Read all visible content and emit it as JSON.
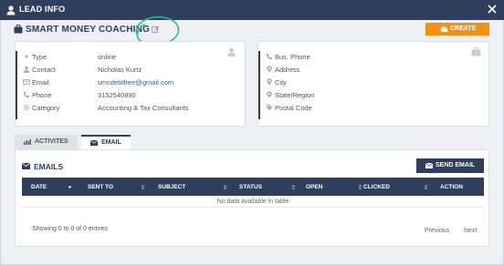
{
  "window": {
    "title": "LEAD INFO",
    "title_icon": "user-icon",
    "close_icon": "close-icon"
  },
  "header": {
    "company": "SMART MONEY COACHING",
    "company_icon": "briefcase-icon",
    "edit_icon": "edit-icon",
    "create_label": "CREATE",
    "create_icon": "briefcase-icon"
  },
  "contact_card": {
    "corner_icon": "user-icon",
    "rows": [
      {
        "label": "Type",
        "value": "online",
        "icon": "dot-icon"
      },
      {
        "label": "Contact",
        "value": "Nicholas Kurtz",
        "icon": "user-icon"
      },
      {
        "label": "Email",
        "value": "smcdebtfree@gmail.com",
        "icon": "envelope-icon"
      },
      {
        "label": "Phone",
        "value": "3152540890",
        "icon": "phone-icon"
      },
      {
        "label": "Category",
        "value": "Accounting & Tax Consultants",
        "icon": "gear-icon"
      }
    ]
  },
  "business_card": {
    "corner_icon": "briefcase-icon",
    "rows": [
      {
        "label": "Bus. Phone",
        "icon": "phone-icon"
      },
      {
        "label": "Address",
        "icon": "map-pin-icon"
      },
      {
        "label": "City",
        "icon": "map-pin-icon"
      },
      {
        "label": "State/Region",
        "icon": "map-pin-icon"
      },
      {
        "label": "Postal Code",
        "icon": "tag-icon"
      }
    ]
  },
  "tabs": [
    {
      "label": "ACTIVITES",
      "icon": "bar-chart-icon",
      "active": false
    },
    {
      "label": "EMAIL",
      "icon": "envelope-icon",
      "active": true
    }
  ],
  "emails": {
    "title": "EMAILS",
    "icon": "envelope-icon",
    "send_label": "SEND EMAIL",
    "send_icon": "envelope-icon",
    "columns": [
      "DATE",
      "SENT TO",
      "SUBJECT",
      "STATUS",
      "OPEN",
      "CLICKED",
      "ACTION"
    ],
    "empty_text": "No data available in table",
    "info": "Showing 0 to 0 of 0 entries",
    "prev": "Previous",
    "next": "Next"
  },
  "colors": {
    "header": "#2f3e5a",
    "create_button": "#f29111",
    "link": "#2a5fa8",
    "annotation": "#2bb59a"
  }
}
